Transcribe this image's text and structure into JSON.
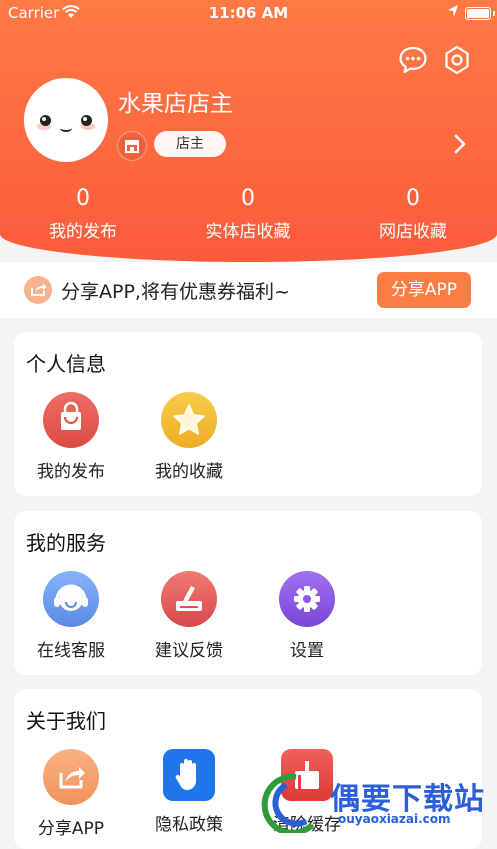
{
  "status_bar": {
    "carrier": "Carrier",
    "time": "11:06 AM"
  },
  "profile": {
    "shop_name": "水果店店主",
    "role": "店主"
  },
  "stats": [
    {
      "value": "0",
      "label": "我的发布"
    },
    {
      "value": "0",
      "label": "实体店收藏"
    },
    {
      "value": "0",
      "label": "网店收藏"
    }
  ],
  "share": {
    "text": "分享APP,将有优惠券福利~",
    "button": "分享APP"
  },
  "personal": {
    "title": "个人信息",
    "items": [
      {
        "label": "我的发布",
        "icon": "bag-icon",
        "color": "#e4574f"
      },
      {
        "label": "我的收藏",
        "icon": "star-icon",
        "color": "#f3bc33"
      }
    ]
  },
  "services": {
    "title": "我的服务",
    "items": [
      {
        "label": "在线客服",
        "icon": "headset-icon",
        "color": "#6f9df0"
      },
      {
        "label": "建议反馈",
        "icon": "feedback-icon",
        "color": "#e66460"
      },
      {
        "label": "设置",
        "icon": "gear-icon",
        "color": "#8b57e6"
      }
    ]
  },
  "about": {
    "title": "关于我们",
    "items": [
      {
        "label": "分享APP",
        "icon": "share-icon",
        "color": "#f4a46c"
      },
      {
        "label": "隐私政策",
        "icon": "hand-icon",
        "color": "#1e76e8"
      },
      {
        "label": "清除缓存",
        "icon": "clear-cache-icon",
        "color": "#e5413e"
      }
    ]
  },
  "watermark": {
    "name": "偶要下载站",
    "url": "ouyaoxiazai.com"
  }
}
